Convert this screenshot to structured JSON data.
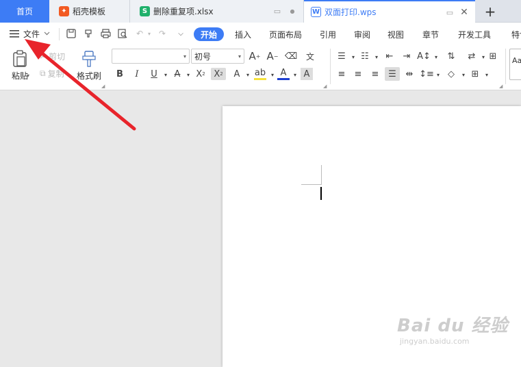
{
  "tabs": {
    "home": "首页",
    "template": "稻壳模板",
    "sheet": "删除重复项.xlsx",
    "doc": "双面打印.wps",
    "sheet_icon": "S"
  },
  "menu": {
    "file": "文件",
    "items": [
      "开始",
      "插入",
      "页面布局",
      "引用",
      "审阅",
      "视图",
      "章节",
      "开发工具",
      "特色"
    ]
  },
  "ribbon": {
    "paste": "粘贴",
    "cut": "剪切",
    "copy": "复制",
    "format_painter": "格式刷",
    "font_name": "",
    "font_size": "初号",
    "style_preview": "Aa"
  },
  "watermark": {
    "brand": "Bai du 经验",
    "url": "jingyan.baidu.com"
  },
  "colors": {
    "accent": "#3d7cf5",
    "arrow": "#e8242b",
    "sheet_green": "#1fb06b",
    "template_orange": "#f25a22"
  }
}
